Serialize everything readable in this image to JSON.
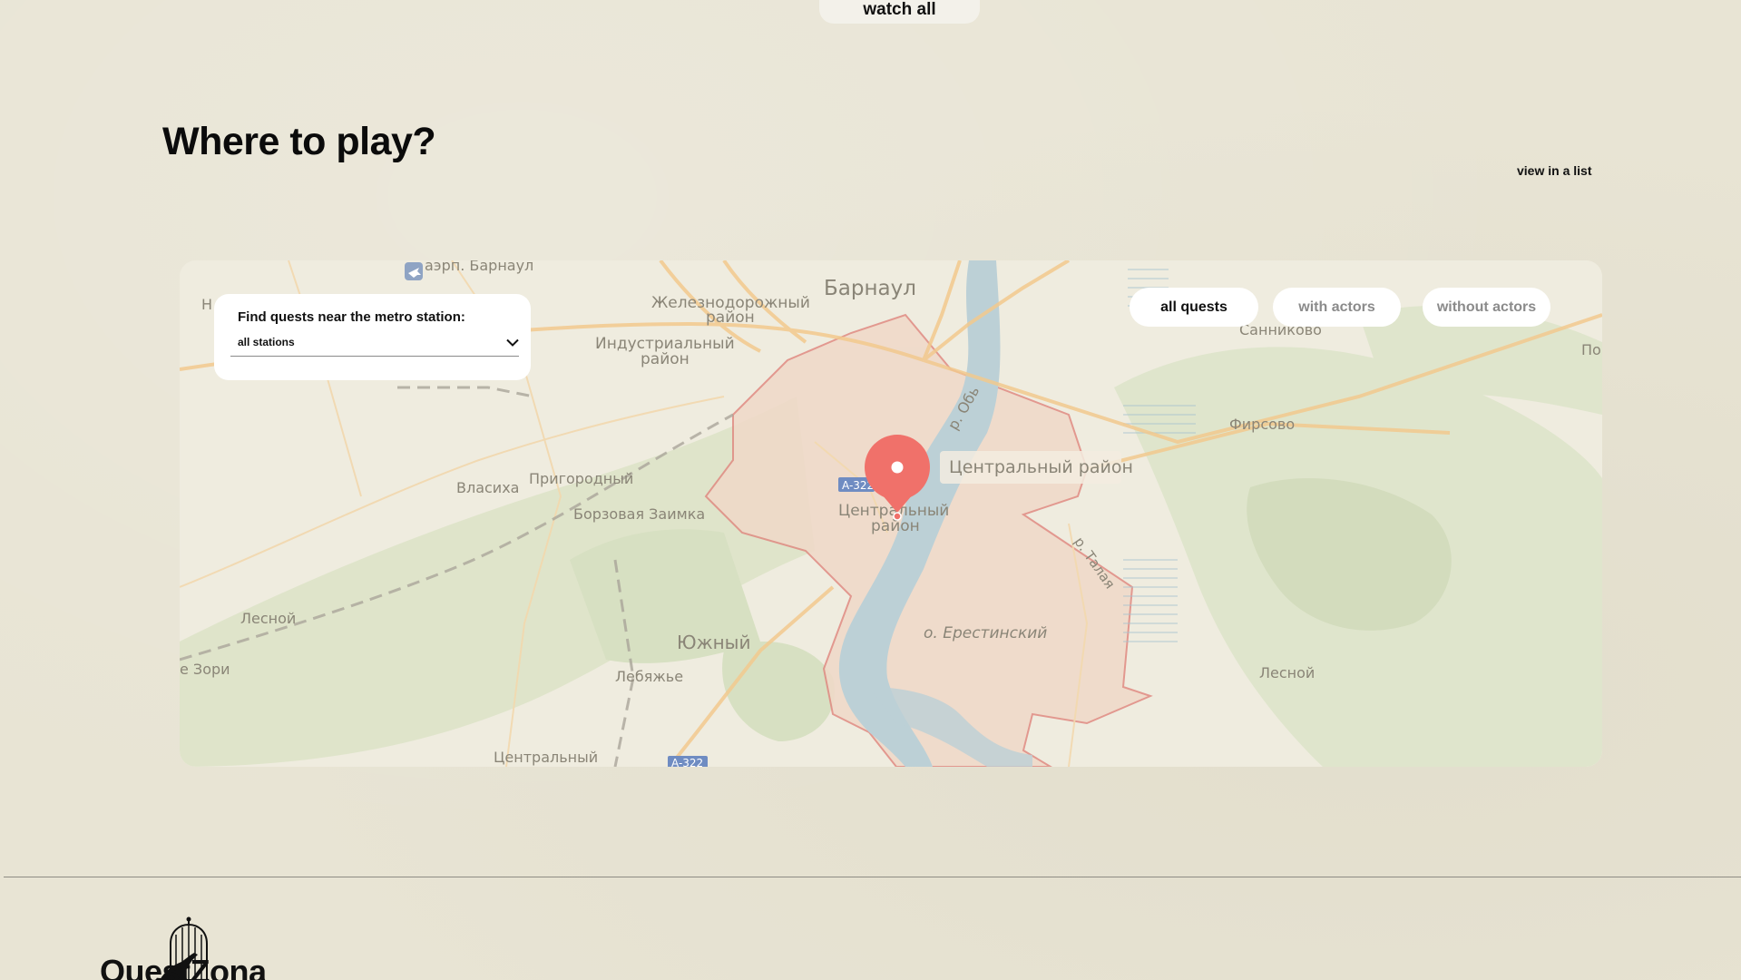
{
  "top": {
    "watch_all_label": "watch all"
  },
  "section": {
    "title": "Where to play?",
    "view_list_label": "view in a list"
  },
  "station_filter": {
    "label": "Find quests near the metro station:",
    "selected": "all stations"
  },
  "filters": [
    {
      "label": "all quests",
      "active": true
    },
    {
      "label": "with actors",
      "active": false
    },
    {
      "label": "without actors",
      "active": false
    }
  ],
  "map": {
    "marker_label": "Центральный район",
    "places": {
      "city": "Барнаул",
      "airport": "аэрп. Барнаул",
      "zheleznodorozhny_1": "Железнодорожный",
      "zheleznodorozhny_2": "район",
      "industrialny_1": "Индустриальный",
      "industrialny_2": "район",
      "prigorodny": "Пригородный",
      "vlasikha": "Власиха",
      "borzovaya": "Борзовая Заимка",
      "tsentralny_1": "Центральный",
      "tsentralny_2": "район",
      "yuzhny": "Южный",
      "lebyazhye": "Лебяжье",
      "lesnoy_w": "Лесной",
      "zori": "е Зори",
      "tsentralny_s": "Центральный",
      "a322_n": "A-322",
      "a322_s": "A-322",
      "ob": "р. Обь",
      "talaya": "р. Талая",
      "erestinsky": "о. Ерестинский",
      "sannikovo": "Санниково",
      "firsovo": "Фирсово",
      "lesnoy_e": "Лесной",
      "po": "По",
      "h": "Н"
    },
    "accent_color": "#f0716a"
  },
  "footer": {
    "brand": "QuestZona"
  }
}
